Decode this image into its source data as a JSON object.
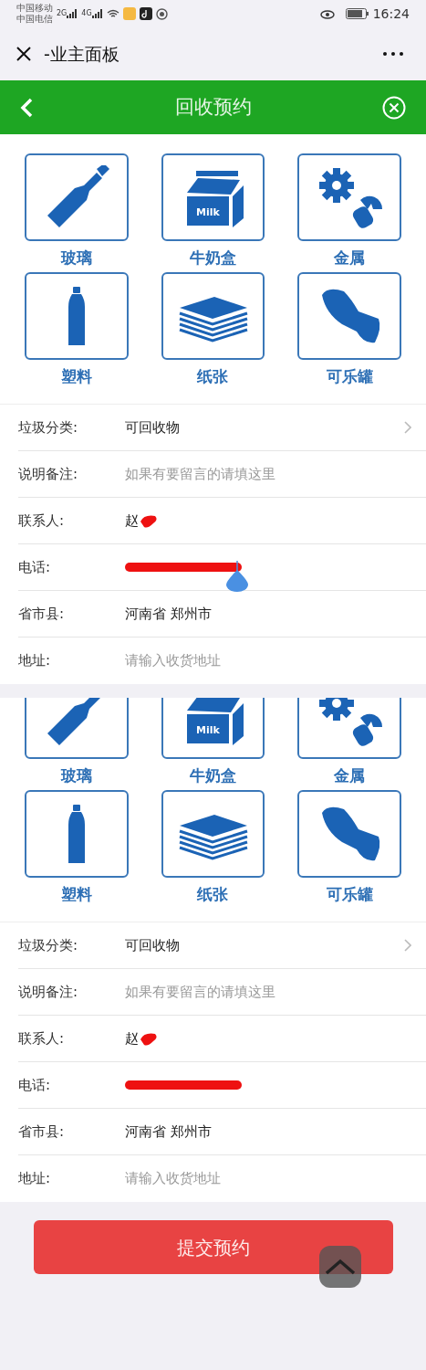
{
  "status_bar": {
    "carriers": [
      "中国移动",
      "中国电信"
    ],
    "networks": [
      "2G",
      "4G"
    ],
    "time": "16:24"
  },
  "title_bar": {
    "title": "-业主面板"
  },
  "header": {
    "title": "回收预约"
  },
  "sections": [
    {
      "clipped": false,
      "categories": [
        {
          "label": "玻璃",
          "kind": "glass"
        },
        {
          "label": "牛奶盒",
          "kind": "carton",
          "icon_text": "Milk"
        },
        {
          "label": "金属",
          "kind": "metal"
        },
        {
          "label": "塑料",
          "kind": "plastic"
        },
        {
          "label": "纸张",
          "kind": "paper"
        },
        {
          "label": "可乐罐",
          "kind": "can"
        }
      ],
      "fields": [
        {
          "label": "垃圾分类:",
          "kind": "select",
          "value": "可回收物",
          "redacted": false,
          "cursor": false
        },
        {
          "label": "说明备注:",
          "kind": "input",
          "placeholder": "如果有要留言的请填这里",
          "redacted": false,
          "cursor": false
        },
        {
          "label": "联系人:",
          "kind": "input",
          "value": "赵",
          "redacted": true,
          "cursor": false
        },
        {
          "label": "电话:",
          "kind": "input",
          "redacted": true,
          "cursor": true
        },
        {
          "label": "省市县:",
          "kind": "select_plain",
          "value": "河南省 郑州市",
          "redacted": false,
          "cursor": false
        },
        {
          "label": "地址:",
          "kind": "input",
          "placeholder": "请输入收货地址",
          "redacted": false,
          "cursor": false
        }
      ]
    },
    {
      "clipped": true,
      "categories": [
        {
          "label": "玻璃",
          "kind": "glass"
        },
        {
          "label": "牛奶盒",
          "kind": "carton",
          "icon_text": "Milk"
        },
        {
          "label": "金属",
          "kind": "metal"
        },
        {
          "label": "塑料",
          "kind": "plastic"
        },
        {
          "label": "纸张",
          "kind": "paper"
        },
        {
          "label": "可乐罐",
          "kind": "can"
        }
      ],
      "fields": [
        {
          "label": "垃圾分类:",
          "kind": "select",
          "value": "可回收物",
          "redacted": false,
          "cursor": false
        },
        {
          "label": "说明备注:",
          "kind": "input",
          "placeholder": "如果有要留言的请填这里",
          "redacted": false,
          "cursor": false
        },
        {
          "label": "联系人:",
          "kind": "input",
          "value": "赵",
          "redacted": true,
          "cursor": false
        },
        {
          "label": "电话:",
          "kind": "input",
          "redacted": true,
          "cursor": false
        },
        {
          "label": "省市县:",
          "kind": "select_plain",
          "value": "河南省 郑州市",
          "redacted": false,
          "cursor": false
        },
        {
          "label": "地址:",
          "kind": "input",
          "placeholder": "请输入收货地址",
          "redacted": false,
          "cursor": false
        }
      ]
    }
  ],
  "submit_button": {
    "label": "提交预约"
  }
}
